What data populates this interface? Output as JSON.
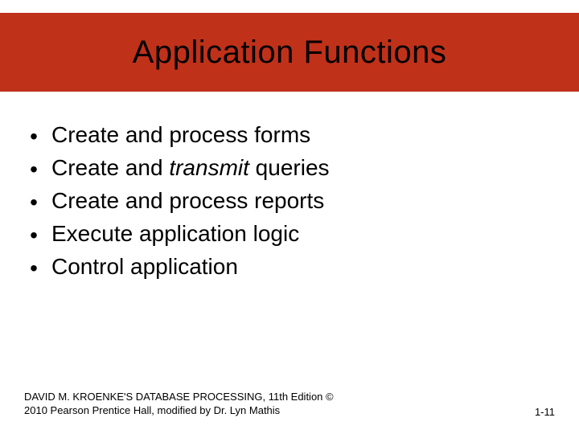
{
  "title": "Application Functions",
  "bullets": [
    {
      "pre": "Create and process forms",
      "em": "",
      "post": ""
    },
    {
      "pre": "Create and ",
      "em": "transmit",
      "post": " queries"
    },
    {
      "pre": "Create and process reports",
      "em": "",
      "post": ""
    },
    {
      "pre": "Execute application logic",
      "em": "",
      "post": ""
    },
    {
      "pre": "Control application",
      "em": "",
      "post": ""
    }
  ],
  "footer": {
    "line1": "DAVID M. KROENKE'S DATABASE PROCESSING, 11th Edition  ©",
    "line2": "2010 Pearson Prentice Hall,  modified by Dr. Lyn Mathis",
    "page": "1-11"
  }
}
